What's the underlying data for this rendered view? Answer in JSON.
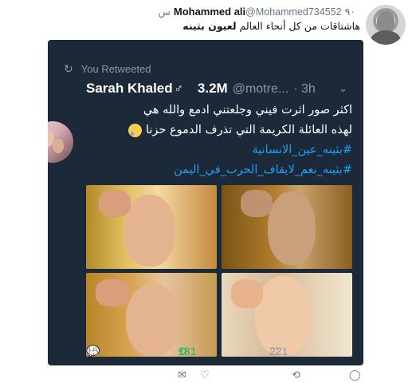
{
  "outer": {
    "name": "Mohammed ali",
    "handle": "@Mohammed734552",
    "time": "٩٠ س",
    "text_plain": "هاشتاقات من كل أنحاء العالم ",
    "text_bold": "لعيون بثينه"
  },
  "inner": {
    "retweeted_label": "You Retweeted",
    "retweet_icon": "↻",
    "name": "Sarah Khaled",
    "gender_symbol": "♂",
    "followers": "3.2M",
    "handle": "@motre...",
    "time": "· 3h",
    "chevron": "⌄",
    "line1": "اكثر صور اثرت فيني وجلعتني ادمع والله هي",
    "line2": "لهذه العائلة الكريمة التي تذرف الدموع حزنا",
    "hashtag1": "#بثينه_عين_الانسانية",
    "hashtag2": "#بثينه_نعم_لايقاف_الحرب_في_اليمن",
    "emoji_icon": "crying-face-icon"
  },
  "inner_actions": {
    "reply_icon": "💬",
    "reply_count": "15",
    "retweet_icon": "⟲",
    "retweet_count": "181",
    "like_icon": "♡",
    "like_count": "221"
  },
  "outer_actions": {
    "mail_icon": "✉",
    "like_icon": "♡",
    "retweet_icon": "⟲",
    "reply_icon": "◯"
  },
  "colors": {
    "card_bg": "#1c2938",
    "hashtag": "#1da1f2",
    "retweet_green": "#17bf63",
    "muted": "#8899a6"
  }
}
